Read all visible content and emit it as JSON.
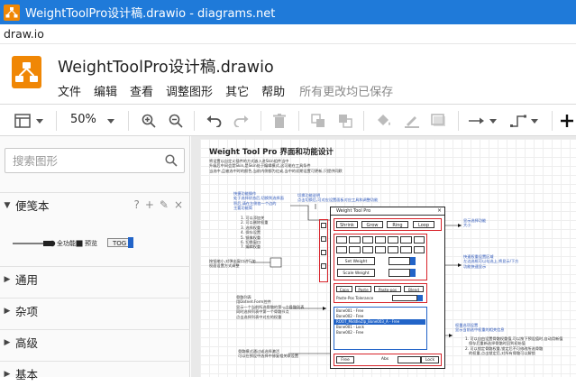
{
  "window": {
    "title": "WeightToolPro设计稿.drawio - diagrams.net",
    "url": "draw.io"
  },
  "document": {
    "title": "WeightToolPro设计稿.drawio",
    "menu": [
      "文件",
      "编辑",
      "查看",
      "调整图形",
      "其它",
      "帮助"
    ],
    "save_status": "所有更改均已保存"
  },
  "toolbar": {
    "zoom": "50%",
    "icons": [
      "page-view-icon",
      "zoom-in-icon",
      "zoom-out-icon",
      "undo-icon",
      "redo-icon",
      "delete-icon",
      "to-front-icon",
      "to-back-icon",
      "fill-color-icon",
      "line-color-icon",
      "shadow-icon",
      "connection-icon",
      "waypoints-icon",
      "insert-icon"
    ]
  },
  "sidebar": {
    "search_placeholder": "搜索图形",
    "scratchpad": {
      "title": "便笺本",
      "tools": [
        "?",
        "+",
        "✎",
        "×"
      ],
      "items": [
        "全功能",
        "预览",
        "TOG"
      ]
    },
    "sections": [
      "通用",
      "杂项",
      "高级",
      "基本"
    ]
  },
  "diagram": {
    "title": "Weight Tool Pro 界面和功能设计",
    "intro": "将设置以自定义插件的方式嵌入进Skin组件当中\n升级后中间会是Skin,是Skin处于编辑模式,这可能在工具条件\n当选中,且被选中时的颜色,当前内侧都为红或,当中的初期设置可更新,只提供同默",
    "panel_title": "Weight Tool Pro",
    "row1": [
      "Shrink",
      "Grow",
      "Ring",
      "Loop"
    ],
    "set_weight": "Set Weight",
    "scale_weight": "Scale Weight",
    "row_copy": [
      "Copy",
      "Paste",
      "Paste-pos",
      "Blend"
    ],
    "tolerance": "Paste-Pos Tolerance",
    "bones": [
      "Bone001 - Free",
      "Bone002 - Free",
      "ROOT_MiddleZlp_Bone003_A - Free",
      "Bone001 - Lock",
      "Bone002 - Free"
    ],
    "bottom": [
      "Free",
      "Abs",
      "Lock"
    ],
    "notes": {
      "left_quick": "快捷功能操作\n处于选择状态后,切换到选择面\n积后,请在左侧各一个边的\n主要功能简",
      "left_list": "1. 可以添加关\n2. 可以删除权重\n3. 选择权重\n4. 保存设置\n5. 镜像权重\n6. 切换窗口\n7. 编辑权重",
      "left_arrow": "按钮缩小,对弹出窗口进行加\n权面设置方式调整",
      "top_mid": "切换功能说明\n点击切换后,可对应设置面板对应工具和调整功能",
      "right_1": "显示选择功能\n大小",
      "right_2": "快速权重设置区域\n左边选框可以勾选上,将显示/下方\n功能快速显示",
      "mid_left": "骨骼列表\n用Dotnet.Form控件\n显示一个当前所选骨骼的第一个骨骼列表\n同时选择列表中第一个骨骼节点\n点击选择列表中对应的权重",
      "right_3": "权重选项设置\n显示当前选中权重的相关信息",
      "right_4": "1. 可以自由设置骨骼权重值,可以按下预设值时,自动用新值\n   保存后重新选择骨骼时回到初始值\n2. 可以锁定骨骼权重,锁定后不可修改所选骨骼\n   的权重,点击锁定后,对所有骨骼可以解锁",
      "bottom_left": "骨骼模式通过或选择激活\n可以在预设中选择中修复相关联设置"
    }
  }
}
